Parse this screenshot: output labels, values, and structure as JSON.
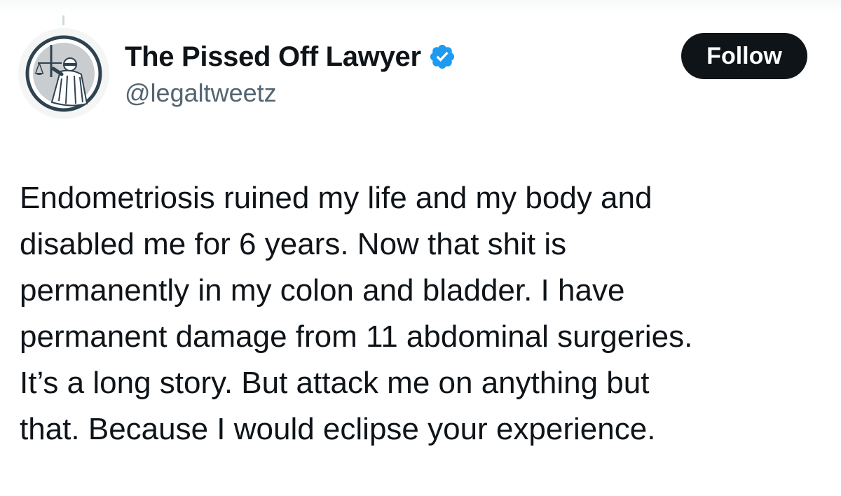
{
  "author": {
    "display_name": "The Pissed Off Lawyer",
    "handle": "@legaltweetz",
    "verified": true,
    "avatar_icon": "lady-justice-icon",
    "verified_icon": "verified-badge-icon",
    "verified_color": "#1d9bf0"
  },
  "actions": {
    "follow_label": "Follow"
  },
  "tweet": {
    "lines": [
      "Endometriosis ruined my life and my body and",
      "disabled me for 6 years. Now that shit is",
      "permanently in my colon and bladder. I have",
      "permanent damage from 11 abdominal surgeries.",
      "It’s a long story. But attack me on anything but",
      "that. Because I would eclipse your experience."
    ]
  },
  "colors": {
    "text_primary": "#0f1419",
    "text_secondary": "#536471",
    "button_bg": "#0f1419",
    "button_text": "#ffffff"
  }
}
